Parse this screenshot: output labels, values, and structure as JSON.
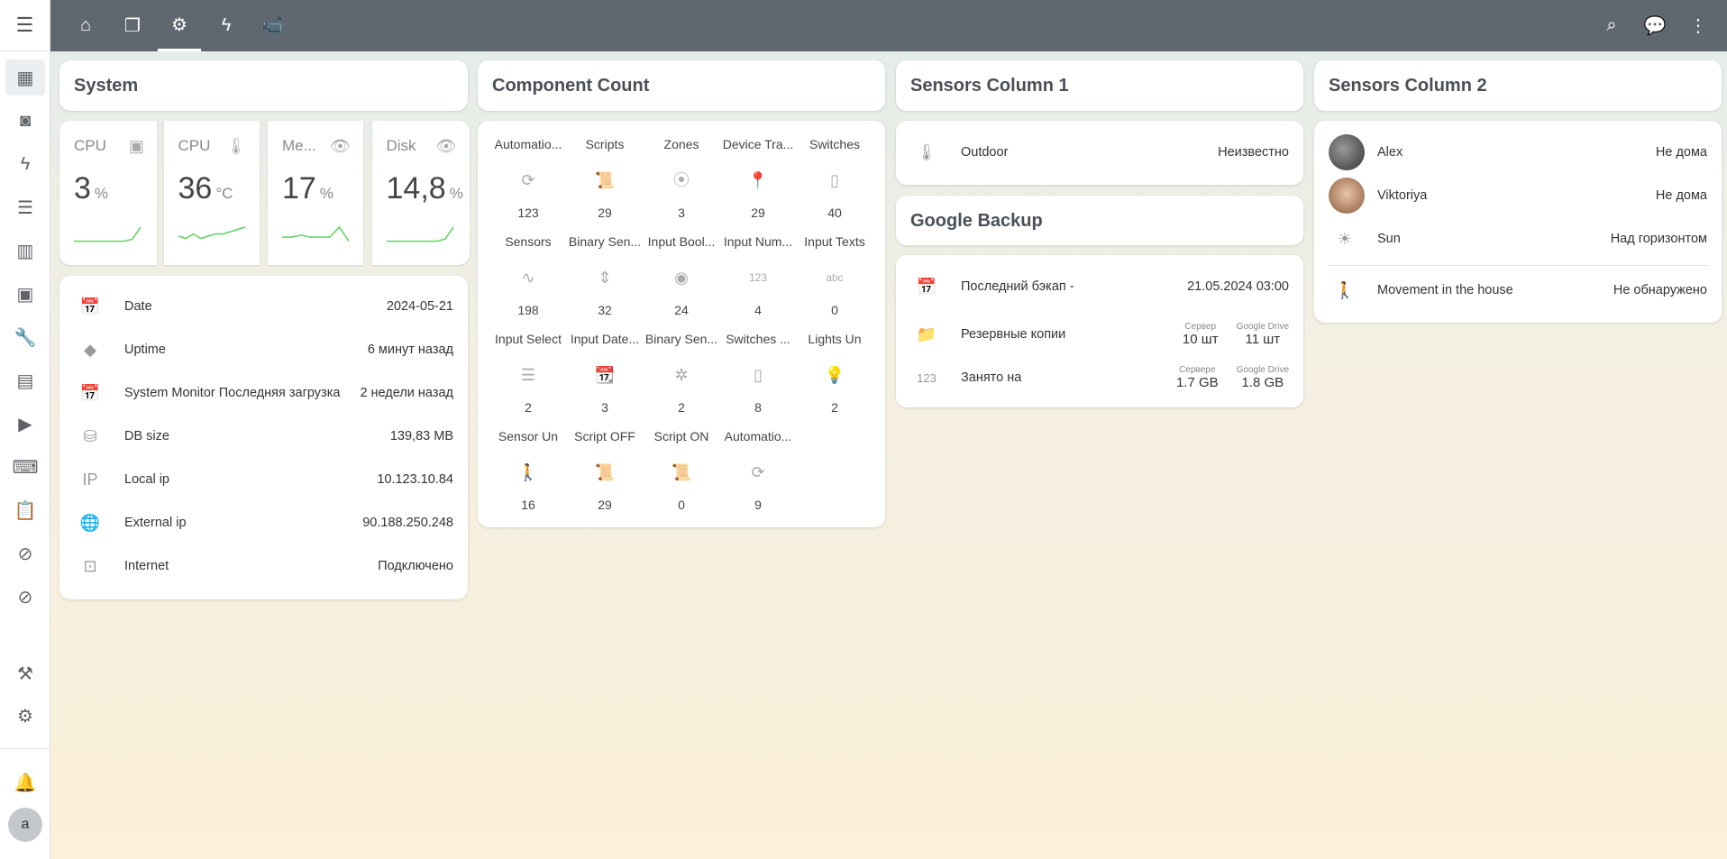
{
  "sidebar": {
    "items": [
      {
        "icon": "dashboard-icon",
        "g": "▦"
      },
      {
        "icon": "map-icon",
        "g": "◙"
      },
      {
        "icon": "energy-icon",
        "g": "ϟ"
      },
      {
        "icon": "logbook-icon",
        "g": "☰"
      },
      {
        "icon": "history-icon",
        "g": "▥"
      },
      {
        "icon": "calendar-icon",
        "g": "▣"
      },
      {
        "icon": "wrench-icon",
        "g": "🔧"
      },
      {
        "icon": "hacs-icon",
        "g": "▤"
      },
      {
        "icon": "media-icon",
        "g": "▶"
      },
      {
        "icon": "terminal-icon",
        "g": "⌨"
      },
      {
        "icon": "clipboard-icon",
        "g": "📋"
      },
      {
        "icon": "zwave-icon",
        "g": "⊘"
      },
      {
        "icon": "zwave2-icon",
        "g": "⊘"
      }
    ],
    "dev": "⚒",
    "settings": "⚙",
    "bell": "🔔",
    "avatar": "a"
  },
  "topbar": {
    "tabs": [
      {
        "icon": "home-icon",
        "g": "⌂"
      },
      {
        "icon": "pages-icon",
        "g": "❐"
      },
      {
        "icon": "gear-icon",
        "g": "⚙"
      },
      {
        "icon": "flash-icon",
        "g": "ϟ"
      },
      {
        "icon": "cctv-icon",
        "g": "📹"
      }
    ],
    "right": [
      {
        "icon": "search-icon",
        "g": "⌕"
      },
      {
        "icon": "assist-icon",
        "g": "💬"
      },
      {
        "icon": "more-icon",
        "g": "⋮"
      }
    ]
  },
  "system": {
    "title": "System",
    "stats": [
      {
        "name": "CPU",
        "icon": "chip-icon",
        "g": "▣",
        "value": "3",
        "unit": "%",
        "spark": [
          2,
          2,
          2,
          2,
          2,
          2,
          2,
          3,
          9
        ]
      },
      {
        "name": "CPU",
        "icon": "thermometer-icon",
        "g": "🌡",
        "value": "36",
        "unit": "°C",
        "spark": [
          4,
          3,
          5,
          3,
          4,
          5,
          5,
          6,
          7,
          8
        ]
      },
      {
        "name": "Me...",
        "icon": "eye-icon",
        "g": "👁",
        "value": "17",
        "unit": "%",
        "spark": [
          4,
          4,
          5,
          4,
          4,
          4,
          9,
          2
        ]
      },
      {
        "name": "Disk",
        "icon": "eye-icon",
        "g": "👁",
        "value": "14,8",
        "unit": "%",
        "spark": [
          2,
          2,
          2,
          2,
          2,
          2,
          2,
          3,
          9
        ]
      }
    ],
    "rows": [
      {
        "icon": "calendar-check-icon",
        "g": "📅",
        "label": "Date",
        "value": "2024-05-21"
      },
      {
        "icon": "uptime-icon",
        "g": "◆",
        "label": "Uptime",
        "value": "6 минут назад"
      },
      {
        "icon": "calendar-icon",
        "g": "📅",
        "label": "System Monitor Последняя загрузка",
        "value": "2 недели назад"
      },
      {
        "icon": "database-icon",
        "g": "⛁",
        "label": "DB size",
        "value": "139,83 MB"
      },
      {
        "icon": "ip-icon",
        "g": "IP",
        "label": "Local ip",
        "value": "10.123.10.84"
      },
      {
        "icon": "globe-icon",
        "g": "🌐",
        "label": "External ip",
        "value": "90.188.250.248"
      },
      {
        "icon": "network-icon",
        "g": "⊡",
        "label": "Internet",
        "value": "Подключено"
      }
    ]
  },
  "components": {
    "title": "Component Count",
    "items": [
      {
        "label": "Automatio...",
        "icon": "autorenew-icon",
        "g": "⟳",
        "value": "123"
      },
      {
        "label": "Scripts",
        "icon": "script-icon",
        "g": "📜",
        "value": "29"
      },
      {
        "label": "Zones",
        "icon": "map-marker-radius-icon",
        "g": "⦿",
        "value": "3"
      },
      {
        "label": "Device Tra...",
        "icon": "map-marker-icon",
        "g": "📍",
        "value": "29"
      },
      {
        "label": "Switches",
        "icon": "switch-icon",
        "g": "▯",
        "value": "40"
      },
      {
        "label": "Sensors",
        "icon": "pulse-icon",
        "g": "∿",
        "value": "198"
      },
      {
        "label": "Binary Sen...",
        "icon": "unfold-icon",
        "g": "⇕",
        "value": "32"
      },
      {
        "label": "Input Bool...",
        "icon": "toggle-icon",
        "g": "◉",
        "value": "24"
      },
      {
        "label": "Input Num...",
        "icon": "numeric-icon",
        "g": "123",
        "value": "4"
      },
      {
        "label": "Input Texts",
        "icon": "text-icon",
        "g": "abc",
        "value": "0"
      },
      {
        "label": "Input Select",
        "icon": "list-icon",
        "g": "☰",
        "value": "2"
      },
      {
        "label": "Input Date...",
        "icon": "calendar-clock-icon",
        "g": "📆",
        "value": "3"
      },
      {
        "label": "Binary Sen...",
        "icon": "motion-off-icon",
        "g": "✲",
        "value": "2"
      },
      {
        "label": "Switches ...",
        "icon": "switch-icon",
        "g": "▯",
        "value": "8"
      },
      {
        "label": "Lights Un",
        "icon": "lightbulb-off-icon",
        "g": "💡",
        "value": "2"
      },
      {
        "label": "Sensor Un",
        "icon": "motion-sensor-icon",
        "g": "🚶",
        "value": "16"
      },
      {
        "label": "Script OFF",
        "icon": "script-icon",
        "g": "📜",
        "value": "29"
      },
      {
        "label": "Script ON",
        "icon": "script-icon",
        "g": "📜",
        "value": "0"
      },
      {
        "label": "Automatio...",
        "icon": "autorenew-icon",
        "g": "⟳",
        "value": "9"
      }
    ]
  },
  "sensors1": {
    "title": "Sensors Column 1",
    "rows": [
      {
        "icon": "thermometer-icon",
        "g": "🌡",
        "label": "Outdoor",
        "value": "Неизвестно"
      }
    ]
  },
  "backup": {
    "title": "Google Backup",
    "last": {
      "icon": "calendar-check-icon",
      "g": "📅",
      "label": "Последний бэкап -",
      "value": "21.05.2024 03:00"
    },
    "copies": {
      "icon": "folder-google-drive-icon",
      "g": "📁",
      "label": "Резервные копии",
      "a_label": "Сервер",
      "a": "10 шт",
      "b_label": "Google Drive",
      "b": "11 шт"
    },
    "used": {
      "icon": "numeric-icon",
      "g": "123",
      "label": "Занято на",
      "a_label": "Сервере",
      "a": "1.7 GB",
      "b_label": "Google Drive",
      "b": "1.8 GB"
    }
  },
  "sensors2": {
    "title": "Sensors Column 2",
    "people": [
      {
        "label": "Alex",
        "value": "Не дома"
      },
      {
        "label": "Viktoriya",
        "value": "Не дома"
      }
    ],
    "sun": {
      "icon": "sun-icon",
      "g": "☀",
      "label": "Sun",
      "value": "Над горизонтом"
    },
    "motion": {
      "icon": "motion-sensor-icon",
      "g": "🚶",
      "label": "Movement in the house",
      "value": "Не обнаружено"
    }
  },
  "colors": {
    "topbar": "#5f6770",
    "spark": "#5fd35f"
  }
}
